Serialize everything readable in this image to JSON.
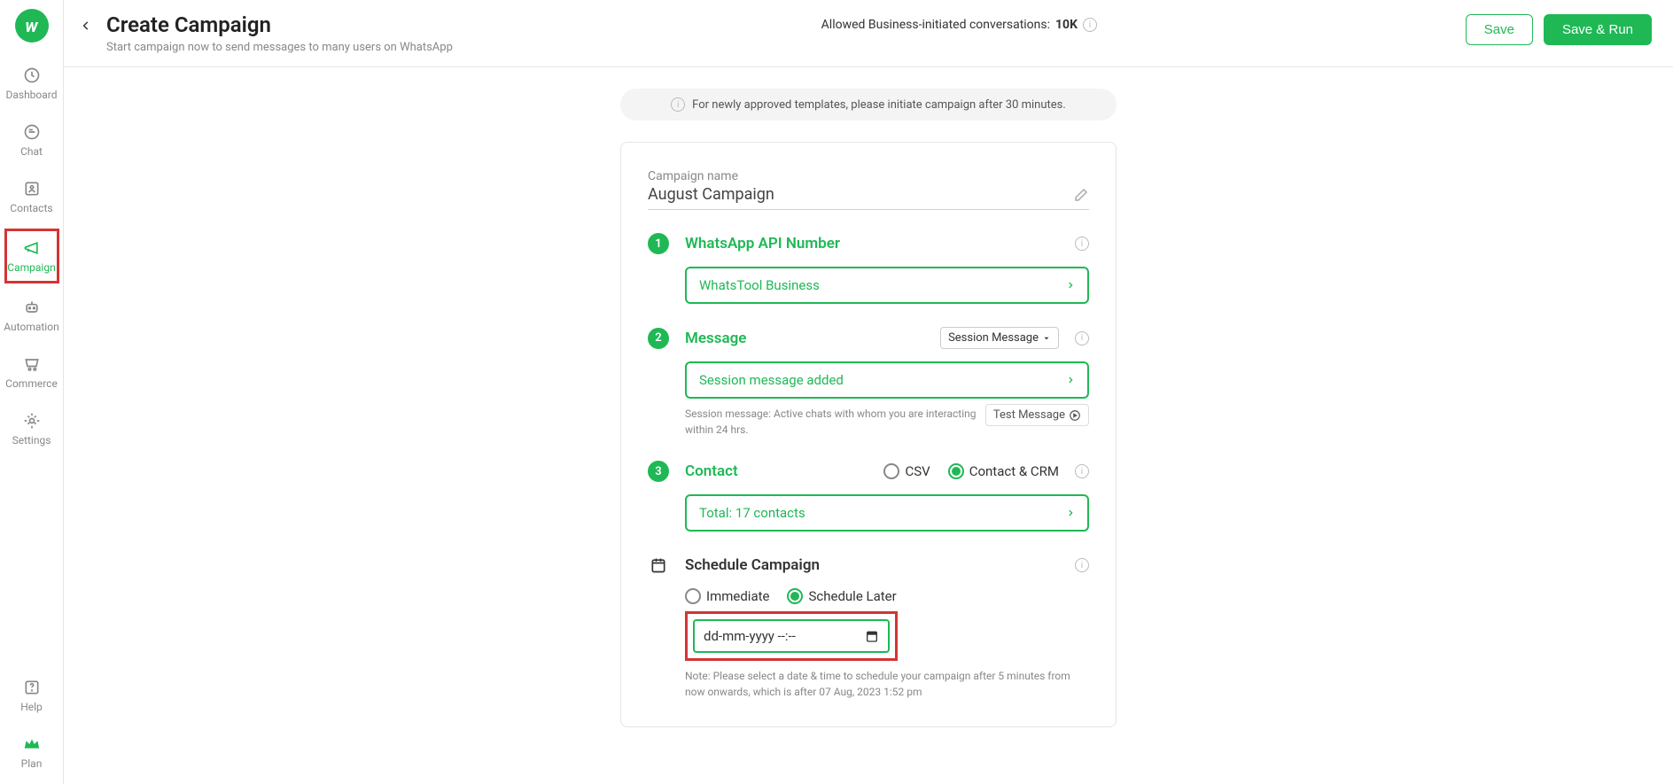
{
  "sidebar": {
    "items": [
      {
        "label": "Dashboard"
      },
      {
        "label": "Chat"
      },
      {
        "label": "Contacts"
      },
      {
        "label": "Campaign"
      },
      {
        "label": "Automation"
      },
      {
        "label": "Commerce"
      },
      {
        "label": "Settings"
      }
    ],
    "help": "Help",
    "plan": "Plan"
  },
  "header": {
    "title": "Create Campaign",
    "subtitle": "Start campaign now to send messages to many users on WhatsApp",
    "allowed_prefix": "Allowed Business-initiated conversations: ",
    "allowed_value": "10K",
    "save": "Save",
    "save_run": "Save & Run"
  },
  "notice": "For newly approved templates, please initiate campaign after 30 minutes.",
  "campaign": {
    "name_label": "Campaign name",
    "name_value": "August Campaign",
    "step1": {
      "title": "WhatsApp API Number",
      "value": "WhatsTool Business"
    },
    "step2": {
      "title": "Message",
      "dropdown": "Session Message",
      "value": "Session message added",
      "hint": "Session message: Active chats with whom you are interacting within 24 hrs.",
      "test": "Test Message"
    },
    "step3": {
      "title": "Contact",
      "opt_csv": "CSV",
      "opt_crm": "Contact & CRM",
      "value": "Total: 17 contacts"
    },
    "schedule": {
      "title": "Schedule Campaign",
      "opt_immediate": "Immediate",
      "opt_later": "Schedule Later",
      "placeholder": "dd-mm-yyyy --:--",
      "note": "Note: Please select a date & time to schedule your campaign after 5 minutes from now onwards, which is after 07 Aug, 2023 1:52 pm"
    }
  }
}
